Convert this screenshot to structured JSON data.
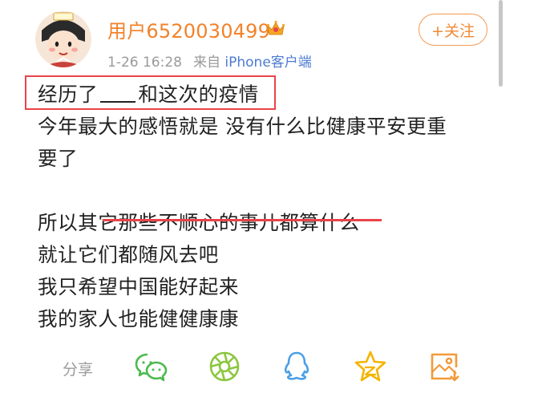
{
  "user": {
    "name": "用户6520030499",
    "time": "1-26 16:28",
    "source_prefix": "来自",
    "source": "iPhone客户端"
  },
  "follow_button": {
    "label": "+关注"
  },
  "post": {
    "lines": [
      "经历了",
      "和这次的疫情",
      "今年最大的感悟就是 没有什么比健康平安更重",
      "要了",
      "所以其它那些不顺心的事儿都算什么",
      "就让它们都随风去吧",
      "我只希望中国能好起来",
      "我的家人也能健健康康"
    ]
  },
  "share": {
    "label": "分享",
    "icons": [
      "wechat-icon",
      "moments-icon",
      "qq-icon",
      "qzone-icon",
      "save-image-icon"
    ]
  },
  "colors": {
    "accent_orange": "#f2822a",
    "link_blue": "#4b7bd1",
    "highlight_red": "#e8444a",
    "wechat_green": "#4cba4e",
    "qq_blue": "#4a9fe6",
    "qzone_yellow": "#f5b400"
  }
}
